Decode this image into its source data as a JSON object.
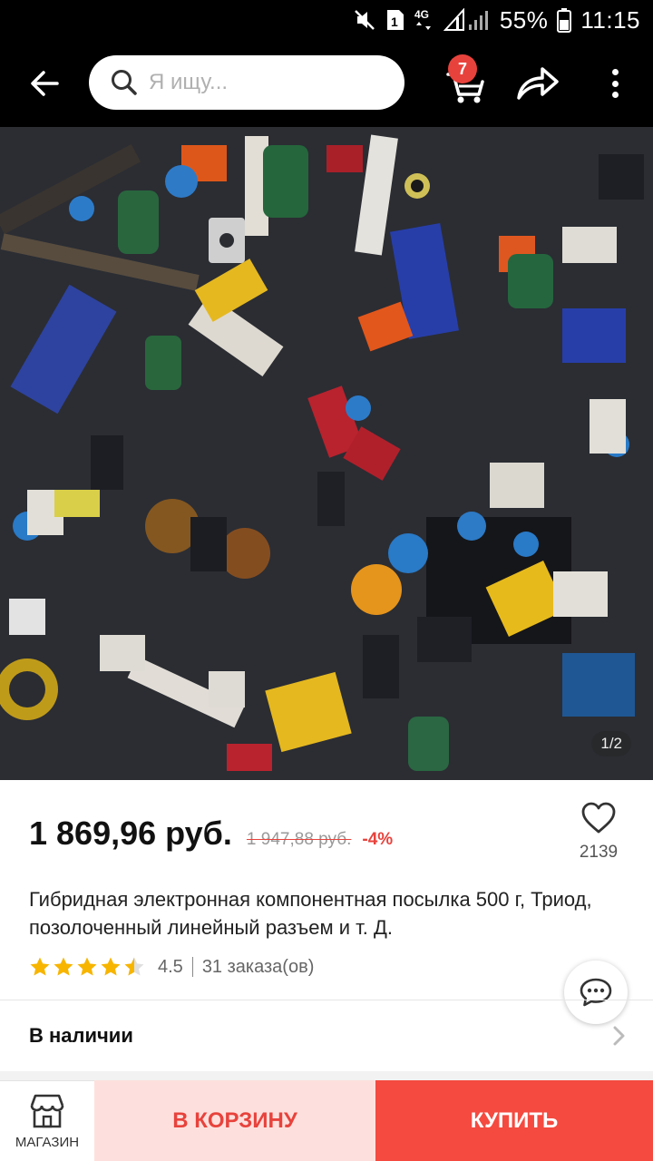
{
  "status_bar": {
    "battery_percent": "55%",
    "time": "11:15",
    "network": "4G",
    "sim_slot": "1",
    "icons": [
      "mute-icon",
      "sim-icon",
      "signal-icon",
      "battery-icon"
    ]
  },
  "header": {
    "search_placeholder": "Я ищу...",
    "cart_count": "7",
    "icons": [
      "back-arrow-icon",
      "search-icon",
      "cart-icon",
      "share-icon",
      "more-icon"
    ]
  },
  "gallery": {
    "counter": "1/2"
  },
  "product": {
    "price": "1 869,96 руб.",
    "old_price": "1 947,88 руб.",
    "discount": "-4%",
    "wishlist_count": "2139",
    "title": "Гибридная электронная компонентная посылка 500 г, Триод, позолоченный линейный разъем и т. Д.",
    "rating": "4.5",
    "rating_stars": 4.5,
    "orders": "31 заказа(ов)"
  },
  "availability": {
    "label": "В наличии"
  },
  "bottom_bar": {
    "store_label": "МАГАЗИН",
    "add_to_cart_label": "В КОРЗИНУ",
    "buy_label": "КУПИТЬ"
  },
  "colors": {
    "accent": "#e8423c",
    "buy_button": "#f44a40",
    "cart_button_bg": "#fde0dd",
    "star": "#f7b500"
  }
}
